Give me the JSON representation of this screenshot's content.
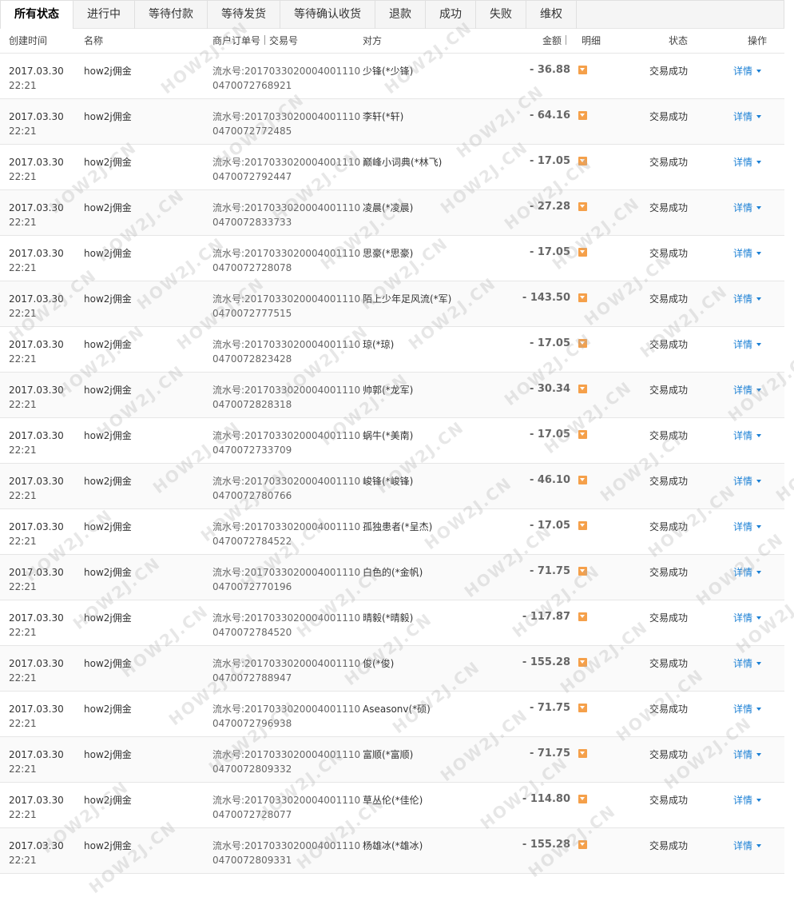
{
  "tabs": [
    "所有状态",
    "进行中",
    "等待付款",
    "等待发货",
    "等待确认收货",
    "退款",
    "成功",
    "失败",
    "维权"
  ],
  "header": {
    "created": "创建时间",
    "name": "名称",
    "order": "商户订单号",
    "trade": "交易号",
    "party": "对方",
    "amount": "金额",
    "detail": "明细",
    "status": "状态",
    "action": "操作"
  },
  "rows": [
    {
      "date": "2017.03.30",
      "time": "22:21",
      "name": "how2j佣金",
      "flow1": "流水号:2017033020004001110",
      "flow2": "0470072768921",
      "party": "少锋(*少锋)",
      "amount": "- 36.88",
      "status": "交易成功",
      "action": "详情"
    },
    {
      "date": "2017.03.30",
      "time": "22:21",
      "name": "how2j佣金",
      "flow1": "流水号:2017033020004001110",
      "flow2": "0470072772485",
      "party": "李轩(*轩)",
      "amount": "- 64.16",
      "status": "交易成功",
      "action": "详情"
    },
    {
      "date": "2017.03.30",
      "time": "22:21",
      "name": "how2j佣金",
      "flow1": "流水号:2017033020004001110",
      "flow2": "0470072792447",
      "party": "巅峰小词典(*林飞)",
      "amount": "- 17.05",
      "status": "交易成功",
      "action": "详情"
    },
    {
      "date": "2017.03.30",
      "time": "22:21",
      "name": "how2j佣金",
      "flow1": "流水号:2017033020004001110",
      "flow2": "0470072833733",
      "party": "凌晨(*凌晨)",
      "amount": "- 27.28",
      "status": "交易成功",
      "action": "详情"
    },
    {
      "date": "2017.03.30",
      "time": "22:21",
      "name": "how2j佣金",
      "flow1": "流水号:2017033020004001110",
      "flow2": "0470072728078",
      "party": "思豪(*思豪)",
      "amount": "- 17.05",
      "status": "交易成功",
      "action": "详情"
    },
    {
      "date": "2017.03.30",
      "time": "22:21",
      "name": "how2j佣金",
      "flow1": "流水号:2017033020004001110",
      "flow2": "0470072777515",
      "party": "陌上少年足风流(*军)",
      "amount": "- 143.50",
      "status": "交易成功",
      "action": "详情"
    },
    {
      "date": "2017.03.30",
      "time": "22:21",
      "name": "how2j佣金",
      "flow1": "流水号:2017033020004001110",
      "flow2": "0470072823428",
      "party": "琼(*琼)",
      "amount": "- 17.05",
      "status": "交易成功",
      "action": "详情"
    },
    {
      "date": "2017.03.30",
      "time": "22:21",
      "name": "how2j佣金",
      "flow1": "流水号:2017033020004001110",
      "flow2": "0470072828318",
      "party": "帅郭(*龙军)",
      "amount": "- 30.34",
      "status": "交易成功",
      "action": "详情"
    },
    {
      "date": "2017.03.30",
      "time": "22:21",
      "name": "how2j佣金",
      "flow1": "流水号:2017033020004001110",
      "flow2": "0470072733709",
      "party": "蜗牛(*美南)",
      "amount": "- 17.05",
      "status": "交易成功",
      "action": "详情"
    },
    {
      "date": "2017.03.30",
      "time": "22:21",
      "name": "how2j佣金",
      "flow1": "流水号:2017033020004001110",
      "flow2": "0470072780766",
      "party": "峻锋(*峻锋)",
      "amount": "- 46.10",
      "status": "交易成功",
      "action": "详情"
    },
    {
      "date": "2017.03.30",
      "time": "22:21",
      "name": "how2j佣金",
      "flow1": "流水号:2017033020004001110",
      "flow2": "0470072784522",
      "party": "孤独患者(*呈杰)",
      "amount": "- 17.05",
      "status": "交易成功",
      "action": "详情"
    },
    {
      "date": "2017.03.30",
      "time": "22:21",
      "name": "how2j佣金",
      "flow1": "流水号:2017033020004001110",
      "flow2": "0470072770196",
      "party": "白色的(*金帆)",
      "amount": "- 71.75",
      "status": "交易成功",
      "action": "详情"
    },
    {
      "date": "2017.03.30",
      "time": "22:21",
      "name": "how2j佣金",
      "flow1": "流水号:2017033020004001110",
      "flow2": "0470072784520",
      "party": "晴毅(*晴毅)",
      "amount": "- 117.87",
      "status": "交易成功",
      "action": "详情"
    },
    {
      "date": "2017.03.30",
      "time": "22:21",
      "name": "how2j佣金",
      "flow1": "流水号:2017033020004001110",
      "flow2": "0470072788947",
      "party": "俊(*俊)",
      "amount": "- 155.28",
      "status": "交易成功",
      "action": "详情"
    },
    {
      "date": "2017.03.30",
      "time": "22:21",
      "name": "how2j佣金",
      "flow1": "流水号:2017033020004001110",
      "flow2": "0470072796938",
      "party": "Aseasonv(*硕)",
      "amount": "- 71.75",
      "status": "交易成功",
      "action": "详情"
    },
    {
      "date": "2017.03.30",
      "time": "22:21",
      "name": "how2j佣金",
      "flow1": "流水号:2017033020004001110",
      "flow2": "0470072809332",
      "party": "富顺(*富顺)",
      "amount": "- 71.75",
      "status": "交易成功",
      "action": "详情"
    },
    {
      "date": "2017.03.30",
      "time": "22:21",
      "name": "how2j佣金",
      "flow1": "流水号:2017033020004001110",
      "flow2": "0470072728077",
      "party": "草丛伦(*佳伦)",
      "amount": "- 114.80",
      "status": "交易成功",
      "action": "详情"
    },
    {
      "date": "2017.03.30",
      "time": "22:21",
      "name": "how2j佣金",
      "flow1": "流水号:2017033020004001110",
      "flow2": "0470072809331",
      "party": "杨雄冰(*雄冰)",
      "amount": "- 155.28",
      "status": "交易成功",
      "action": "详情"
    }
  ],
  "watermark": "HOW2J.CN",
  "colors": {
    "link": "#1a7fd4",
    "detail_icon": "#f5a04a",
    "row_alt": "#fafafa"
  }
}
